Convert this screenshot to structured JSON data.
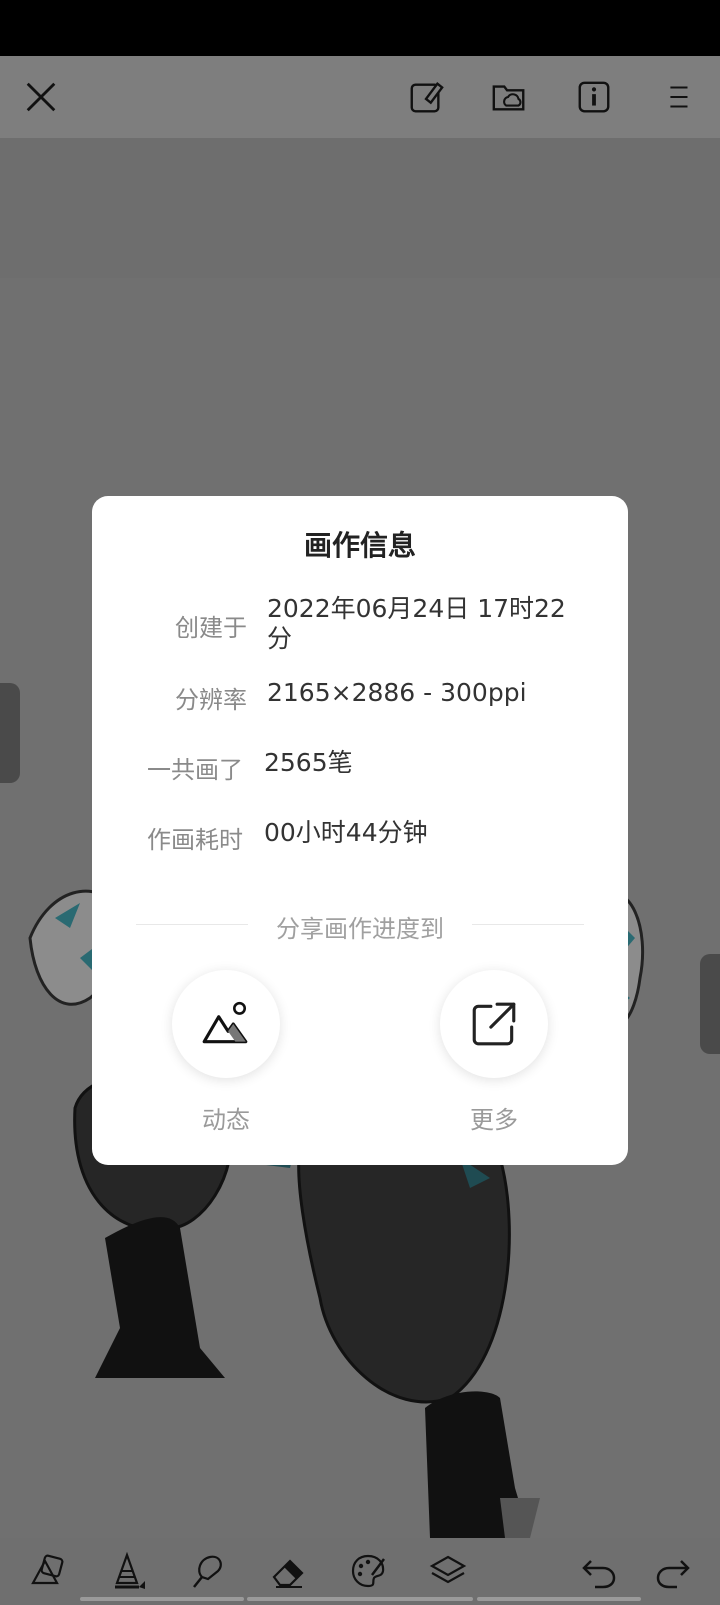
{
  "modal": {
    "title": "画作信息",
    "info": [
      {
        "label": "创建于",
        "value": "2022年06月24日 17时22分"
      },
      {
        "label": "分辨率",
        "value": "2165×2886 - 300ppi"
      },
      {
        "label": "一共画了",
        "value": "2565笔"
      },
      {
        "label": "作画耗时",
        "value": "00小时44分钟"
      }
    ],
    "share_title": "分享画作进度到",
    "share_options": [
      {
        "label": "动态",
        "icon": "mountain-image-icon"
      },
      {
        "label": "更多",
        "icon": "external-share-icon"
      }
    ]
  },
  "toolbar_top": {
    "icons": [
      "close-icon",
      "edit-canvas-icon",
      "cloud-folder-icon",
      "info-icon",
      "menu-icon"
    ]
  },
  "toolbar_bottom": {
    "tools": [
      "shapes-icon",
      "pen-icon",
      "smudge-icon",
      "eraser-icon",
      "palette-icon",
      "layers-icon",
      "undo-icon",
      "redo-icon"
    ]
  },
  "colors": {
    "overlay": "#6b6b6b",
    "modal_bg": "#ffffff",
    "label_gray": "#8a8a8a",
    "value_dark": "#333333"
  }
}
